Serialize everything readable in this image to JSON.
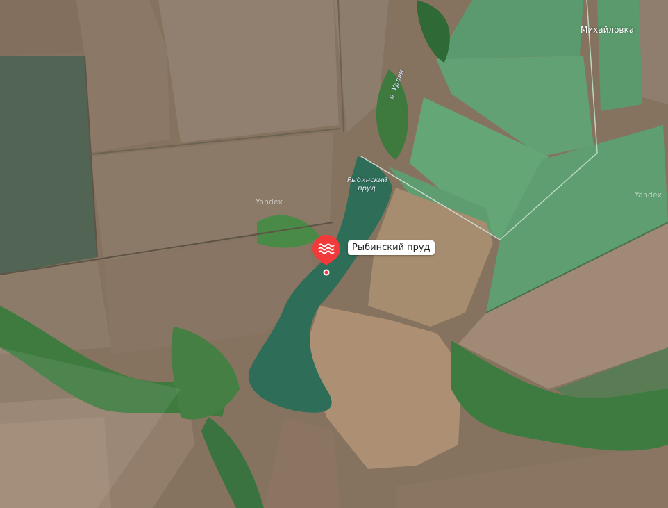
{
  "map": {
    "provider_watermark": "Yandex",
    "layer": "satellite",
    "labels": {
      "village": "Михайловка",
      "river": "р. Урляи",
      "water_body_line1": "Рыбинский",
      "water_body_line2": "пруд"
    },
    "poi": {
      "name": "Рыбинский пруд",
      "icon": "water-waves-icon",
      "marker_color": "#f33a3a"
    },
    "colors": {
      "water": "#2e6e58",
      "field_brown": "#8f7d6a",
      "field_green": "#5f9a6c",
      "vegetation": "#3e7a3f"
    }
  }
}
